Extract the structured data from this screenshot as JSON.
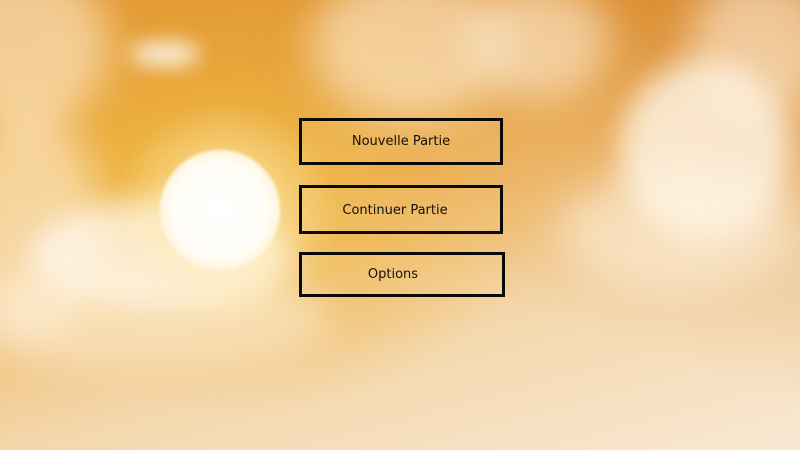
{
  "menu": {
    "new_game_label": "Nouvelle Partie",
    "continue_label": "Continuer Partie",
    "options_label": "Options"
  },
  "colors": {
    "sky_top": "#e2982c",
    "sky_bottom": "#f8e8d3",
    "button_border": "#0c0a08",
    "button_text": "#111111"
  },
  "background": {
    "scene": "sunset-sky-with-clouds"
  }
}
